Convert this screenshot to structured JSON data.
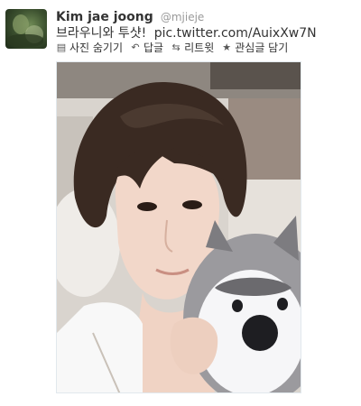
{
  "tweet": {
    "author_name": "Kim jae joong",
    "author_handle": "@mjieje",
    "text": "브라우니와 투샷!",
    "link": "pic.twitter.com/AuixXw7N",
    "actions": [
      {
        "label": "사진 숨기기",
        "icon": "photo-hide-icon"
      },
      {
        "label": "답글",
        "icon": "reply-icon"
      },
      {
        "label": "리트윗",
        "icon": "retweet-icon"
      },
      {
        "label": "관심글 담기",
        "icon": "star-icon"
      }
    ]
  },
  "colors": {
    "name": "#333333",
    "handle": "#999999",
    "border": "#e1e8ed"
  }
}
